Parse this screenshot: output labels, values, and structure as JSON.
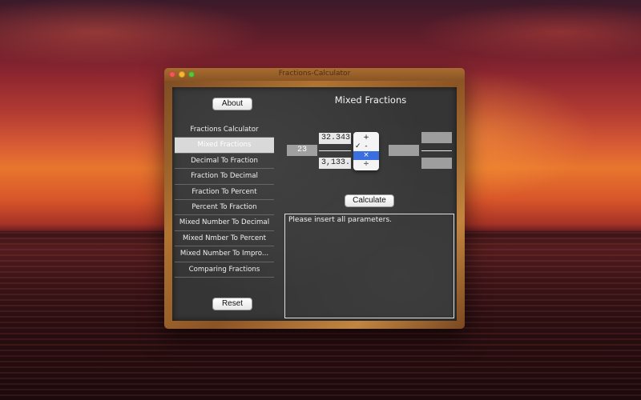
{
  "window": {
    "title": "Fractions-Calculator"
  },
  "header": {
    "title": "Mixed Fractions"
  },
  "buttons": {
    "about": "About",
    "reset": "Reset",
    "calculate": "Calculate"
  },
  "sidebar": {
    "items": [
      {
        "label": "Fractions Calculator",
        "selected": false
      },
      {
        "label": "Mixed Fractions",
        "selected": true
      },
      {
        "label": "Decimal To Fraction",
        "selected": false
      },
      {
        "label": "Fraction To Decimal",
        "selected": false
      },
      {
        "label": "Fraction To Percent",
        "selected": false
      },
      {
        "label": "Percent To Fraction",
        "selected": false
      },
      {
        "label": "Mixed Number To Decimal",
        "selected": false
      },
      {
        "label": "Mixed Nmber To Percent",
        "selected": false
      },
      {
        "label": "Mixed Number To Impro...",
        "selected": false
      },
      {
        "label": "Comparing Fractions",
        "selected": false
      }
    ]
  },
  "inputs": {
    "whole": "23",
    "numerator": "32.343",
    "denominator": "3,133."
  },
  "operators": {
    "options": [
      "+",
      "-",
      "×",
      "÷"
    ],
    "checked": "-",
    "highlighted": "×",
    "check_mark": "✓"
  },
  "output": {
    "message": "Please insert all parameters."
  },
  "colors": {
    "board": "#353535",
    "selection": "#3a6fe0",
    "wood": "#b07432"
  }
}
